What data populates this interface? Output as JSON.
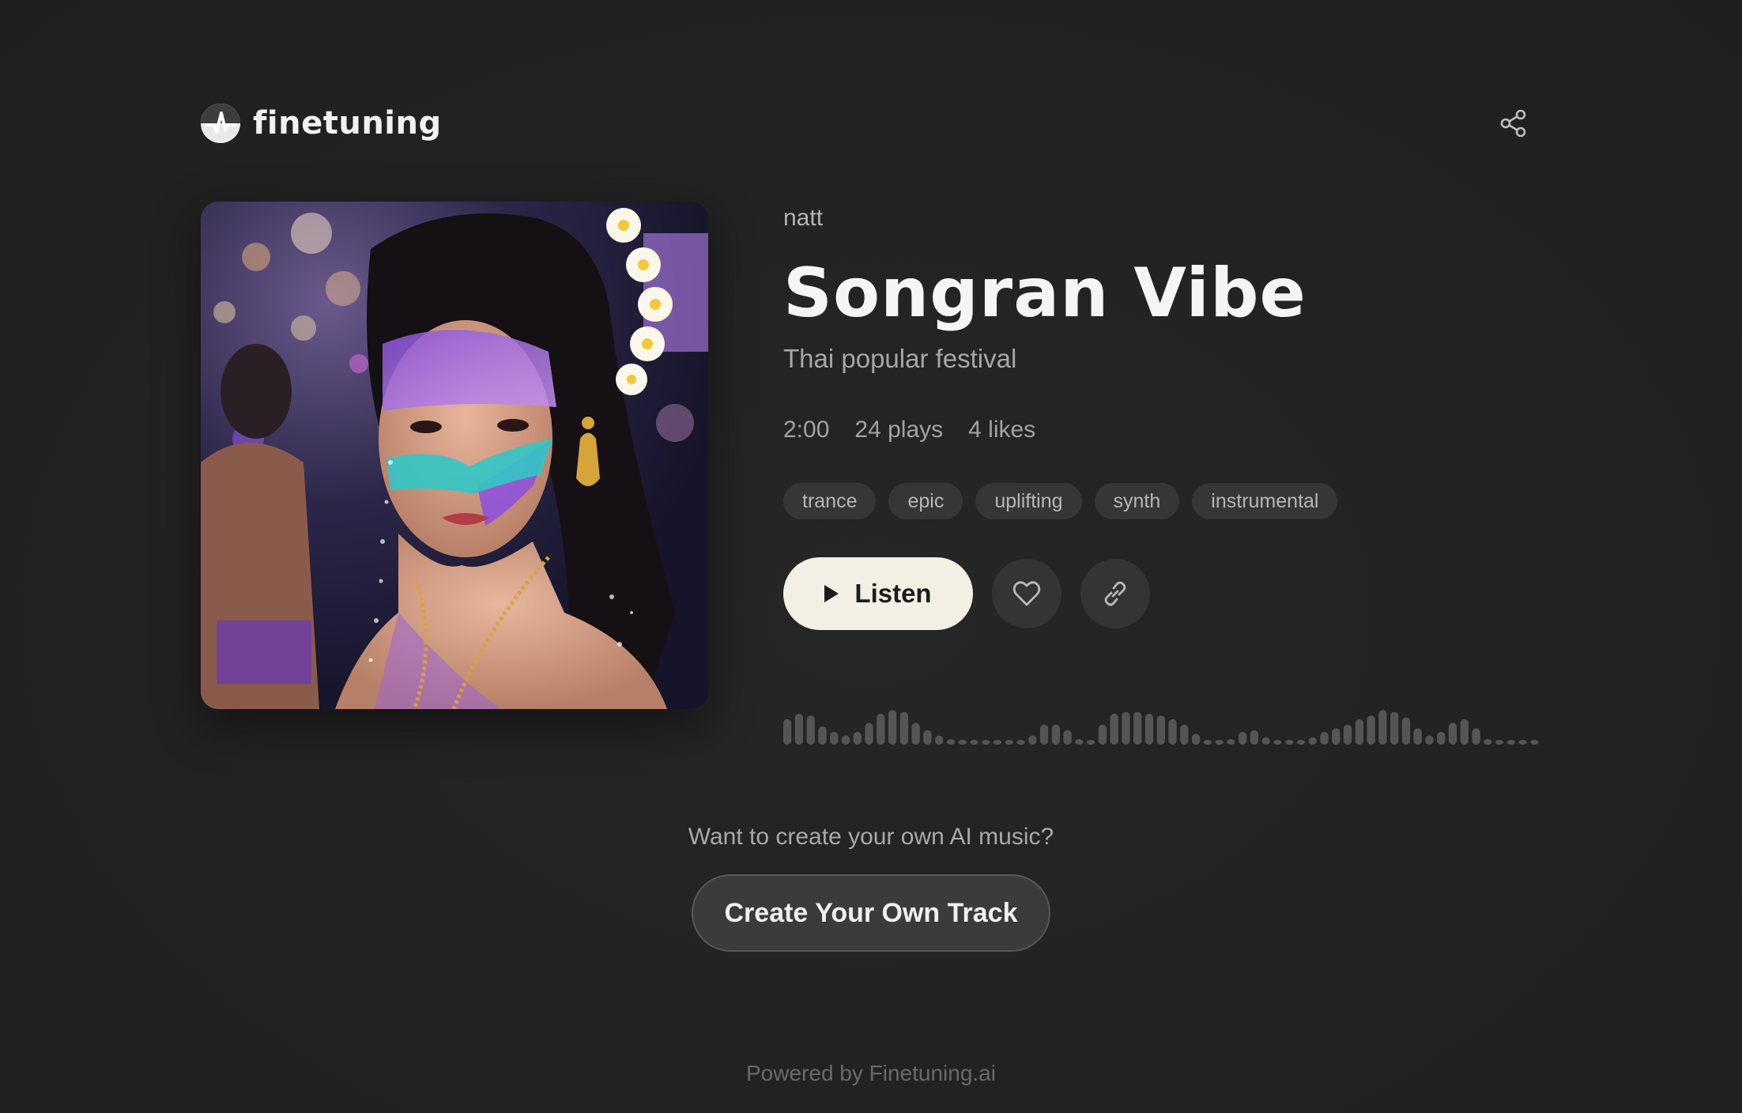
{
  "brand": {
    "name": "finetuning"
  },
  "track": {
    "artist": "natt",
    "title": "Songran Vibe",
    "description": "Thai popular festival",
    "duration": "2:00",
    "plays": "24 plays",
    "likes": "4 likes",
    "tags": [
      "trance",
      "epic",
      "uplifting",
      "synth",
      "instrumental"
    ]
  },
  "actions": {
    "listen_label": "Listen"
  },
  "waveform_levels": [
    0.7,
    0.85,
    0.8,
    0.5,
    0.35,
    0.25,
    0.35,
    0.6,
    0.85,
    0.95,
    0.9,
    0.6,
    0.4,
    0.25,
    0.15,
    0.12,
    0.1,
    0.1,
    0.1,
    0.1,
    0.1,
    0.25,
    0.55,
    0.55,
    0.4,
    0.15,
    0.1,
    0.55,
    0.85,
    0.9,
    0.9,
    0.85,
    0.8,
    0.7,
    0.55,
    0.3,
    0.1,
    0.1,
    0.15,
    0.35,
    0.4,
    0.2,
    0.1,
    0.1,
    0.1,
    0.2,
    0.35,
    0.45,
    0.55,
    0.7,
    0.8,
    0.95,
    0.9,
    0.75,
    0.45,
    0.25,
    0.35,
    0.6,
    0.7,
    0.45,
    0.15,
    0.1,
    0.1,
    0.1,
    0.1
  ],
  "colors": {
    "background": "#232323",
    "listen_button": "#f3efe4",
    "tag_bg": "#363636",
    "waveform": "#555555"
  },
  "cta": {
    "question": "Want to create your own AI music?",
    "button_label": "Create Your Own Track"
  },
  "footer": {
    "text": "Powered by Finetuning.ai"
  }
}
